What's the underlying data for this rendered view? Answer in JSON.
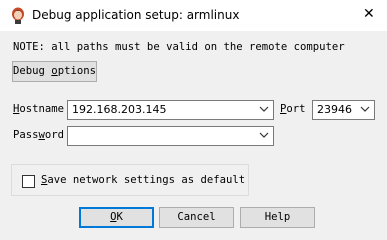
{
  "window": {
    "title": "Debug application setup: armlinux",
    "close_glyph": "✕",
    "icon": "app-icon"
  },
  "note": "NOTE: all paths must be valid on the remote computer",
  "debug_options": {
    "pre": "Debug ",
    "accel": "o",
    "post": "ptions"
  },
  "hostname": {
    "pre": "",
    "accel": "H",
    "post": "ostname",
    "value": "192.168.203.145"
  },
  "port": {
    "pre": "",
    "accel": "P",
    "post": "ort",
    "value": "23946"
  },
  "password": {
    "pre": "Pass",
    "accel": "w",
    "post": "ord",
    "value": ""
  },
  "save_settings": {
    "pre": "",
    "accel": "S",
    "post": "ave network settings as default",
    "checked": false
  },
  "buttons": {
    "ok": {
      "pre": "",
      "accel": "O",
      "post": "K"
    },
    "cancel": {
      "label": "Cancel"
    },
    "help": {
      "label": "Help"
    }
  },
  "colors": {
    "background": "#f0f0f0",
    "default_button_border": "#0078d7"
  }
}
